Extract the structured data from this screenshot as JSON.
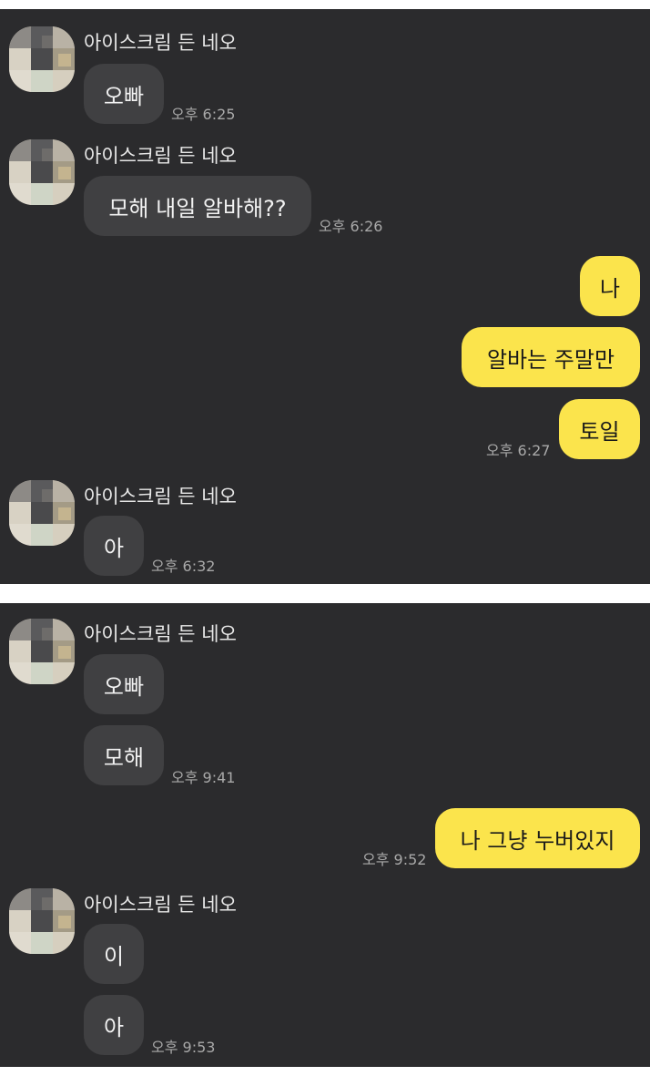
{
  "contact": {
    "name": "아이스크림 든 네오"
  },
  "colors": {
    "background": "#2b2b2d",
    "incoming_bubble": "#404042",
    "outgoing_bubble": "#fbe44c",
    "timestamp": "#a9a9a9",
    "name": "#e8e8e8"
  },
  "icons": {
    "avatar": "pixelated-profile-avatar"
  },
  "panel1": {
    "g1": {
      "messages": [
        "오빠"
      ],
      "time": "오후 6:25"
    },
    "g2": {
      "messages": [
        "모해 내일 알바해??"
      ],
      "time": "오후 6:26"
    },
    "g3": {
      "messages": [
        "나",
        "알바는 주말만",
        "토일"
      ],
      "time": "오후 6:27"
    },
    "g4": {
      "messages": [
        "아"
      ],
      "time": "오후 6:32"
    }
  },
  "panel2": {
    "g1": {
      "messages": [
        "오빠",
        "모해"
      ],
      "time": "오후 9:41"
    },
    "g2": {
      "messages": [
        "나 그냥 누버있지"
      ],
      "time": "오후 9:52"
    },
    "g3": {
      "messages": [
        "이",
        "아"
      ],
      "time": "오후 9:53"
    }
  }
}
